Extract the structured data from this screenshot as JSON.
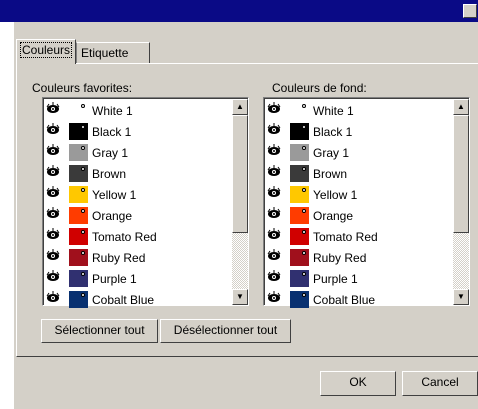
{
  "tabs": [
    {
      "label": "Couleurs",
      "active": true
    },
    {
      "label": "Etiquette",
      "active": false
    }
  ],
  "favorites": {
    "label": "Couleurs favorites:",
    "items": [
      {
        "name": "White 1",
        "color": "#ffffff"
      },
      {
        "name": "Black 1",
        "color": "#000000"
      },
      {
        "name": "Gray 1",
        "color": "#9a9a9a"
      },
      {
        "name": "Brown",
        "color": "#3a3a3a"
      },
      {
        "name": "Yellow 1",
        "color": "#ffc800"
      },
      {
        "name": "Orange",
        "color": "#ff3c00"
      },
      {
        "name": "Tomato Red",
        "color": "#d00000"
      },
      {
        "name": "Ruby Red",
        "color": "#a0101c"
      },
      {
        "name": "Purple 1",
        "color": "#303070"
      },
      {
        "name": "Cobalt Blue",
        "color": "#083070"
      }
    ]
  },
  "background": {
    "label": "Couleurs de fond:",
    "items": [
      {
        "name": "White 1",
        "color": "#ffffff"
      },
      {
        "name": "Black 1",
        "color": "#000000"
      },
      {
        "name": "Gray 1",
        "color": "#9a9a9a"
      },
      {
        "name": "Brown",
        "color": "#3a3a3a"
      },
      {
        "name": "Yellow 1",
        "color": "#ffc800"
      },
      {
        "name": "Orange",
        "color": "#ff3c00"
      },
      {
        "name": "Tomato Red",
        "color": "#d00000"
      },
      {
        "name": "Ruby Red",
        "color": "#a0101c"
      },
      {
        "name": "Purple 1",
        "color": "#303070"
      },
      {
        "name": "Cobalt Blue",
        "color": "#083070"
      }
    ]
  },
  "buttons": {
    "select_all": "Sélectionner tout",
    "deselect_all": "Désélectionner tout",
    "ok": "OK",
    "cancel": "Cancel"
  },
  "icons": {
    "eye": "eye-icon",
    "scroll_up": "▲",
    "scroll_down": "▼"
  }
}
